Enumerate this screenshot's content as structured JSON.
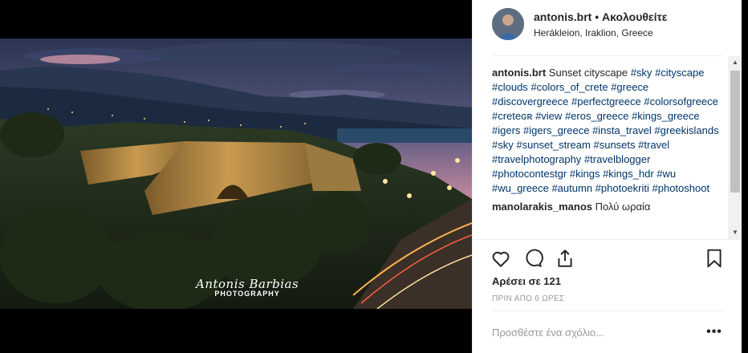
{
  "post": {
    "username": "antonis.brt",
    "separator": "•",
    "follow_label": "Ακολουθείτε",
    "location": "Herákleion, Iraklion, Greece"
  },
  "photo": {
    "watermark_signature": "Antonis Barbias",
    "watermark_subtitle": "PHOTOGRAPHY"
  },
  "caption": {
    "username": "antonis.brt",
    "text": "Sunset cityscape",
    "hashtags": [
      "#sky",
      "#cityscape",
      "#clouds",
      "#colors_of_crete",
      "#greece",
      "#discovergreece",
      "#perfectgreece",
      "#colorsofgreece",
      "#creteɢʀ",
      "#view",
      "#eros_greece",
      "#kings_greece",
      "#igers",
      "#igers_greece",
      "#insta_travel",
      "#greekislands",
      "#sky",
      "#sunset_stream",
      "#sunsets",
      "#travel",
      "#travelphotography",
      "#travelblogger",
      "#photocontestgr",
      "#kings",
      "#kings_hdr",
      "#wu",
      "#wu_greece",
      "#autumn",
      "#photoekriti",
      "#photoshoot"
    ]
  },
  "next_comment": {
    "username": "manolarakis_manos",
    "text": "Πολύ ωραία"
  },
  "actions": {
    "like_icon": "heart-icon",
    "comment_icon": "comment-bubble-icon",
    "share_icon": "share-icon",
    "save_icon": "bookmark-icon"
  },
  "likes_label": "Αρέσει σε 121",
  "timestamp": "ΠΡΙΝ ΑΠΟ 6 ΩΡΕΣ",
  "add_comment": {
    "placeholder": "Προσθέστε ένα σχόλιο...",
    "more_label": "•••"
  },
  "colors": {
    "hashtag": "#003569",
    "text": "#262626",
    "muted": "#999999",
    "divider": "#efefef"
  }
}
